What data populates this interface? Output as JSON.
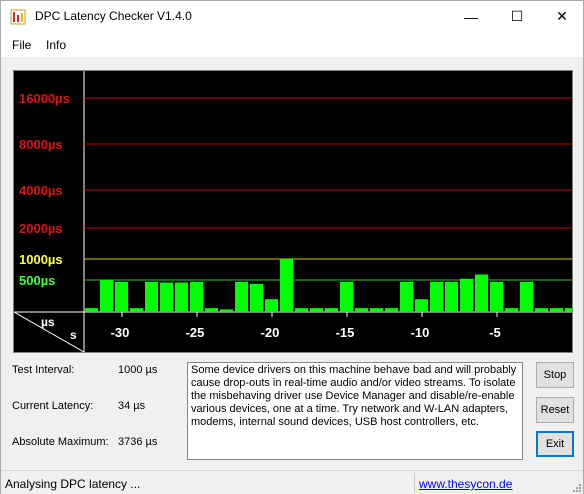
{
  "window": {
    "title": "DPC Latency Checker V1.4.0",
    "minimize_glyph": "—",
    "maximize_glyph": "☐",
    "close_glyph": "✕"
  },
  "menu": {
    "items": [
      "File",
      "Info"
    ]
  },
  "graph": {
    "y_labels": [
      {
        "text": "16000µs",
        "color": "#e01010"
      },
      {
        "text": "8000µs",
        "color": "#e01010"
      },
      {
        "text": "4000µs",
        "color": "#e01010"
      },
      {
        "text": "2000µs",
        "color": "#e01010"
      },
      {
        "text": "1000µs",
        "color": "#ffff40"
      },
      {
        "text": "500µs",
        "color": "#40ff40"
      }
    ],
    "corner_top": "µs",
    "corner_bottom": "s",
    "x_ticks": [
      "-30",
      "-25",
      "-20",
      "-15",
      "-10",
      "-5"
    ],
    "bar_color": "#00ff00",
    "bars_us": [
      60,
      505,
      470,
      60,
      470,
      460,
      460,
      470,
      60,
      40,
      470,
      440,
      200,
      1000,
      60,
      60,
      60,
      470,
      60,
      60,
      60,
      470,
      200,
      470,
      470,
      520,
      600,
      470,
      60,
      470,
      60,
      60,
      60
    ]
  },
  "fields": {
    "test_interval_label": "Test Interval:",
    "test_interval_value": "1000 µs",
    "current_latency_label": "Current Latency:",
    "current_latency_value": "34 µs",
    "absolute_max_label": "Absolute Maximum:",
    "absolute_max_value": "3736 µs"
  },
  "info_text": "Some device drivers on this machine behave bad and will probably cause drop-outs in real-time audio and/or video streams. To isolate the misbehaving driver use Device Manager and disable/re-enable various devices, one at a time. Try network and W-LAN adapters, modems, internal sound devices, USB host controllers, etc.",
  "buttons": {
    "stop": "Stop",
    "reset": "Reset",
    "exit": "Exit"
  },
  "status": {
    "text": "Analysing DPC latency ...",
    "link": "www.thesycon.de"
  }
}
